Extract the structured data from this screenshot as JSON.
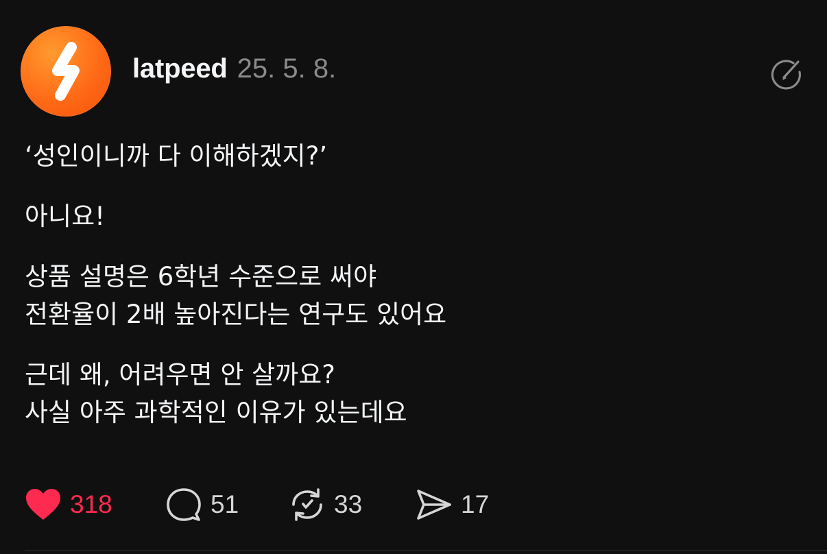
{
  "post": {
    "username": "latpeed",
    "date": "25. 5. 8.",
    "avatar_icon": "lightning-s-logo",
    "paragraphs": [
      [
        "‘성인이니까 다 이해하겠지?’"
      ],
      [
        "아니요!"
      ],
      [
        "상품 설명은 6학년 수준으로 써야",
        "전환율이 2배 높아진다는 연구도 있어요"
      ],
      [
        "근데 왜, 어려우면 안 살까요?",
        "사실 아주 과학적인 이유가 있는데요"
      ]
    ],
    "actions": {
      "like_count": "318",
      "comment_count": "51",
      "repost_count": "33",
      "share_count": "17"
    }
  },
  "colors": {
    "background": "#101010",
    "text": "#f3f5f7",
    "muted": "#8b8b8b",
    "like": "#ff2a4f",
    "avatar": "#ff6a16"
  }
}
